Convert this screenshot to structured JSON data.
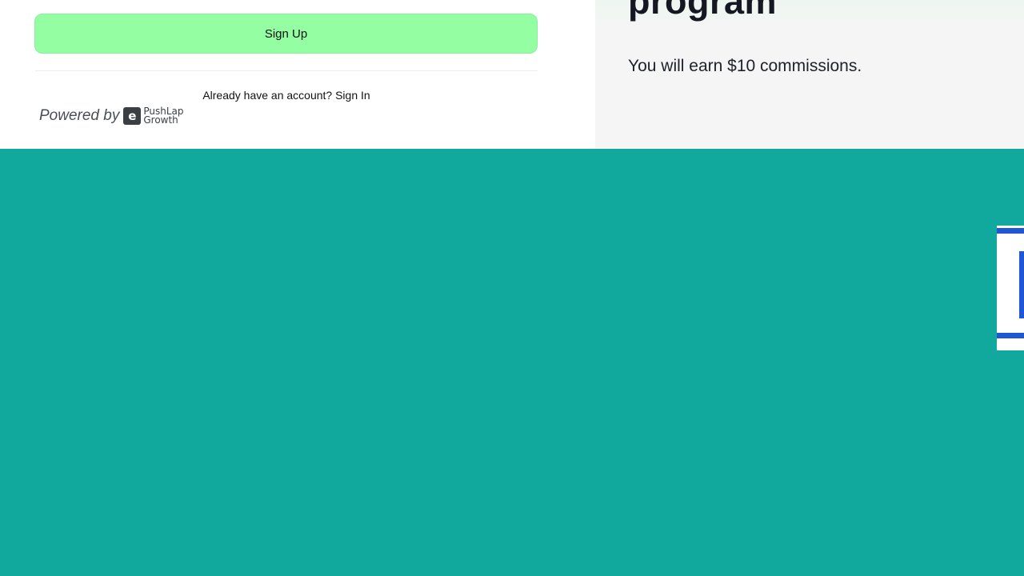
{
  "signup": {
    "button_label": "Sign Up"
  },
  "signin": {
    "prompt": "Already have an account? ",
    "link_label": "Sign In"
  },
  "powered_by": {
    "label": "Powered by",
    "logo_mark": "e",
    "logo_line1": "PushLap",
    "logo_line2": "Growth"
  },
  "program": {
    "title": "program",
    "commission_text": "You will earn $10 commissions."
  },
  "colors": {
    "background": "#11a89d",
    "signup_button": "#93fea2",
    "widget_accent": "#1f56d6"
  }
}
